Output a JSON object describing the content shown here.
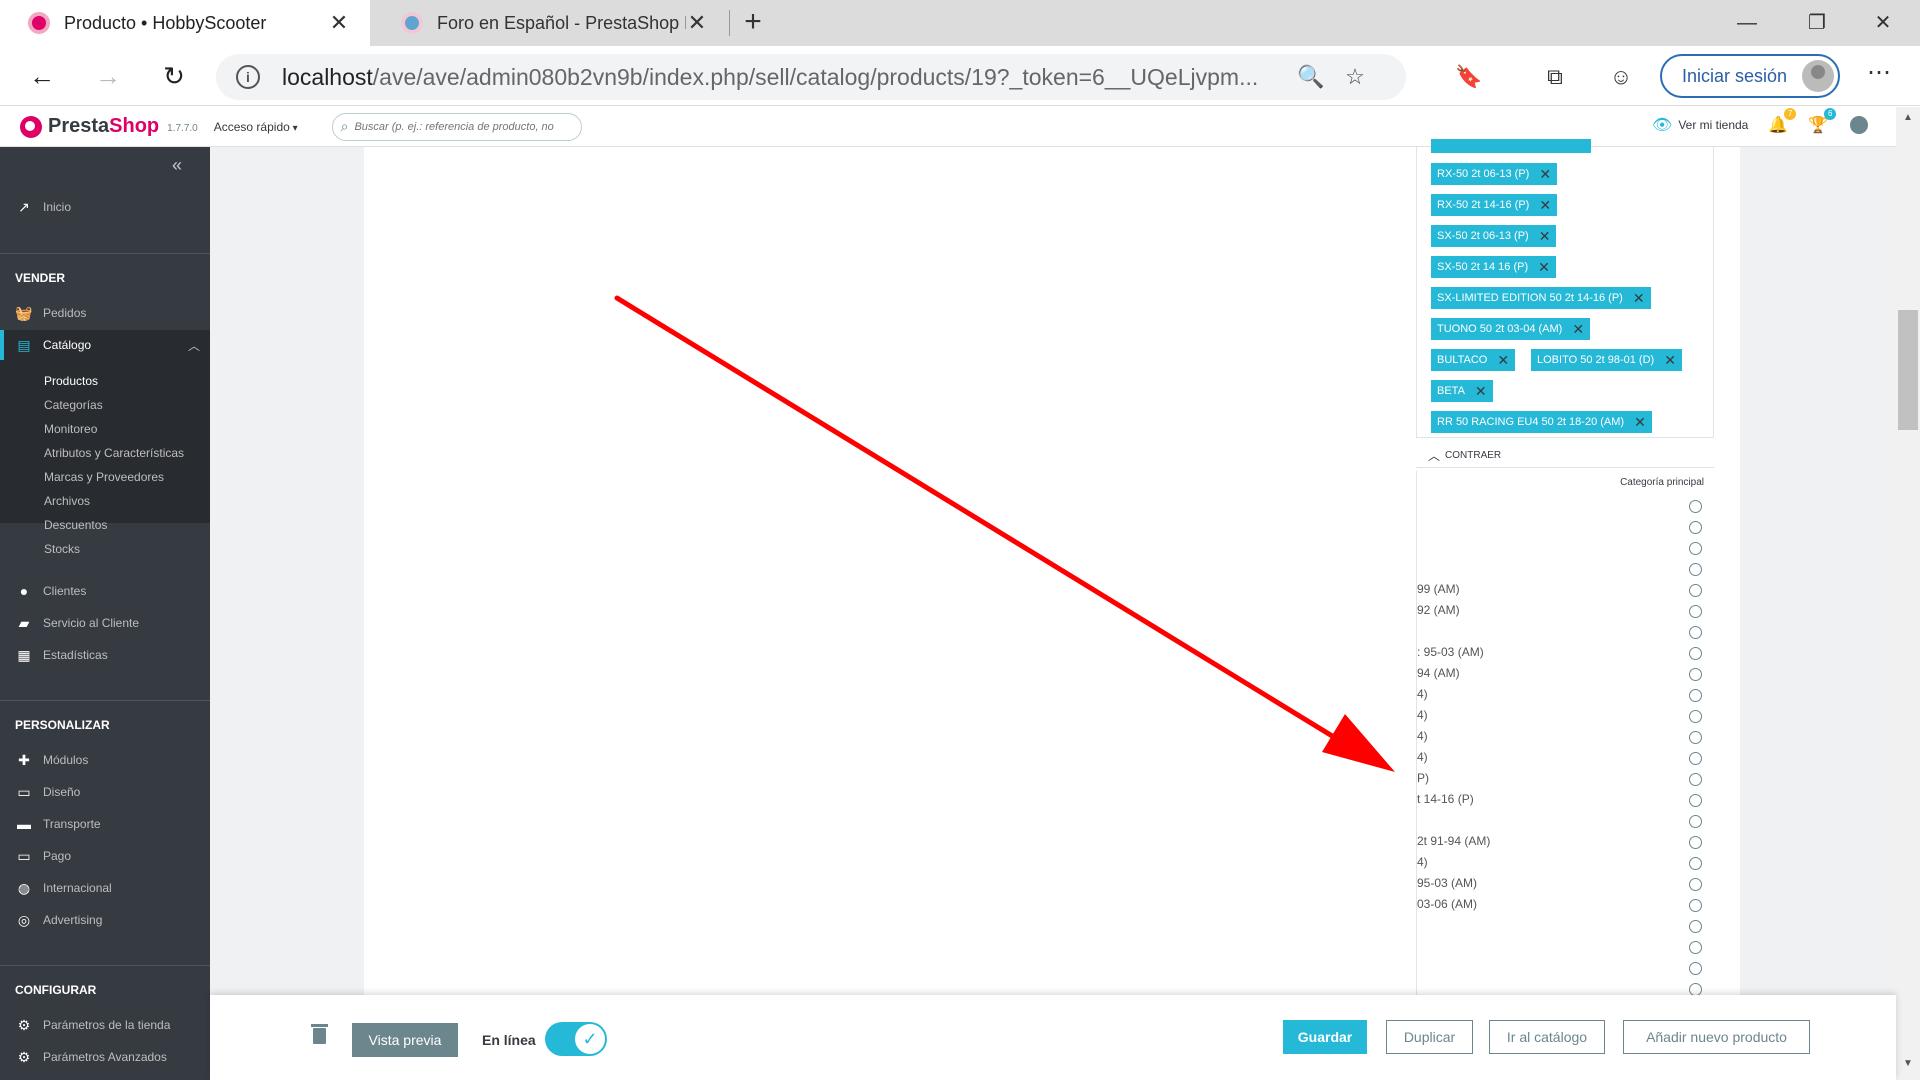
{
  "browser": {
    "tabs": [
      {
        "title": "Producto • HobbyScooter",
        "close": "✕"
      },
      {
        "title": "Foro en Español - PrestaShop Fo",
        "close": "✕"
      }
    ],
    "new_tab": "+",
    "window": {
      "minimize": "—",
      "maximize": "❐",
      "close": "✕"
    },
    "nav": {
      "back": "←",
      "forward": "→",
      "reload": "↻"
    },
    "url_host": "localhost",
    "url_path": "/ave/ave/admin080b2vn9b/index.php/sell/catalog/products/19?_token=6__UQeLjvpm...",
    "icons": {
      "zoom": "🔍",
      "favorite": "☆",
      "bookmark": "🔖",
      "collections": "⧉",
      "feedback": "☺"
    },
    "signin_label": "Iniciar sesión",
    "more": "⋯"
  },
  "ps_header": {
    "brand_main": "Presta",
    "brand_accent": "Shop",
    "version": "1.7.7.0",
    "quick_access": "Acceso rápido",
    "search_placeholder": "Buscar (p. ej.: referencia de producto, no",
    "view_shop": "Ver mi tienda",
    "notif_badge": "7",
    "orders_badge": "6"
  },
  "sidebar": {
    "collapse": "«",
    "home": "Inicio",
    "sections": {
      "sell": "VENDER",
      "customize": "PERSONALIZAR",
      "configure": "CONFIGURAR"
    },
    "sell_items": {
      "orders": "Pedidos",
      "catalog": "Catálogo",
      "customers": "Clientes",
      "service": "Servicio al Cliente",
      "stats": "Estadísticas"
    },
    "catalog_sub": [
      "Productos",
      "Categorías",
      "Monitoreo",
      "Atributos y Características",
      "Marcas y Proveedores",
      "Archivos",
      "Descuentos",
      "Stocks"
    ],
    "customize_items": {
      "modules": "Módulos",
      "design": "Diseño",
      "shipping": "Transporte",
      "payment": "Pago",
      "intl": "Internacional",
      "advertising": "Advertising"
    },
    "configure_items": {
      "shop_params": "Parámetros de la tienda",
      "adv_params": "Parámetros Avanzados"
    }
  },
  "categories": {
    "tags": [
      "RX-50 2t 06-13 (P)",
      "RX-50 2t 14-16 (P)",
      "SX-50 2t 06-13 (P)",
      "SX-50 2t 14 16 (P)",
      "SX-LIMITED EDITION 50 2t 14-16 (P)",
      "TUONO 50 2t 03-04 (AM)",
      "BULTACO",
      "LOBITO 50 2t 98-01 (D)",
      "BETA",
      "RR 50 RACING EU4 50 2t 18-20 (AM)"
    ],
    "tag_remove": "✕",
    "collapse_label": "CONTRAER",
    "main_category_header": "Categoría principal",
    "tree_labels": [
      "99 (AM)",
      "92 (AM)",
      ": 95-03 (AM)",
      "94 (AM)",
      "4)",
      "4)",
      "4)",
      "4)",
      "P)",
      "t 14-16 (P)",
      "2t 91-94 (AM)",
      "4)",
      "95-03 (AM)",
      "03-06 (AM)"
    ]
  },
  "footer": {
    "preview": "Vista previa",
    "online": "En línea",
    "save": "Guardar",
    "duplicate": "Duplicar",
    "to_catalog": "Ir al catálogo",
    "add_new": "Añadir nuevo producto"
  },
  "colors": {
    "accent": "#25b9d7",
    "brand": "#df0067",
    "sidebar": "#363a41",
    "arrow": "#ff0000"
  }
}
